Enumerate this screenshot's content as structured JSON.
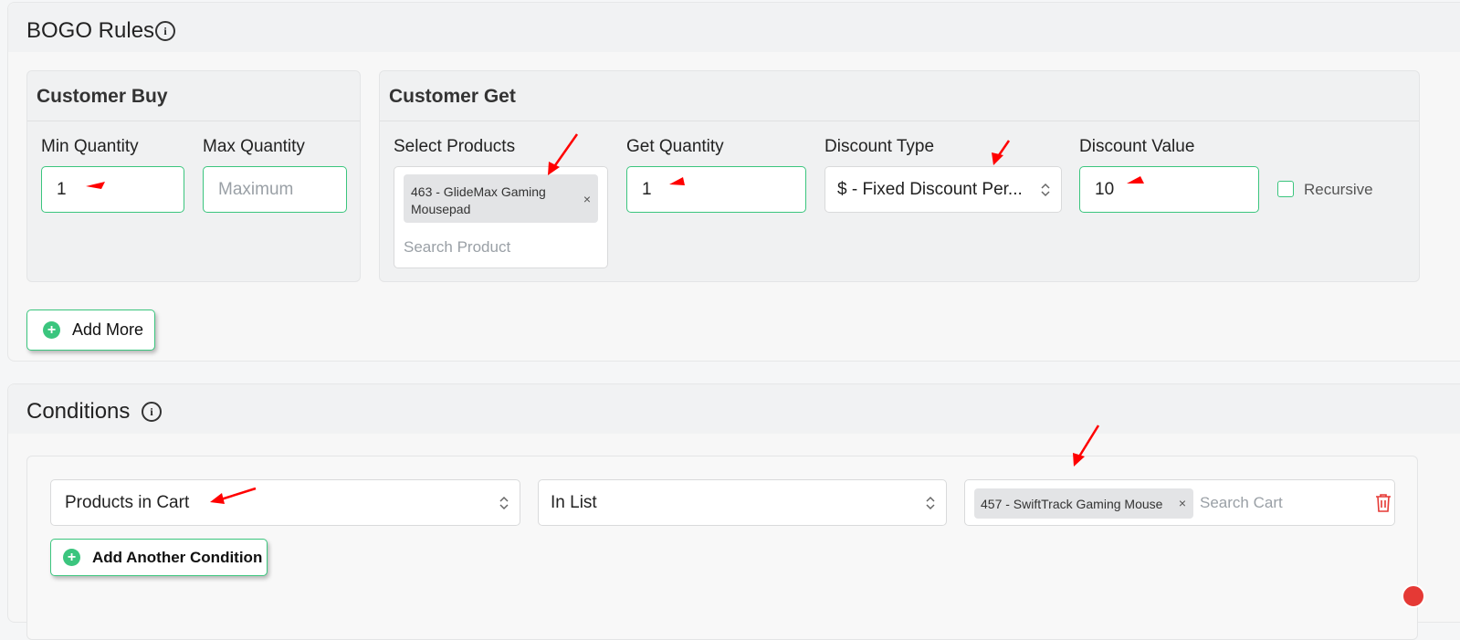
{
  "bogo": {
    "title": "BOGO Rules",
    "customer_buy": {
      "title": "Customer Buy",
      "min_label": "Min Quantity",
      "min_value": "1",
      "max_label": "Max Quantity",
      "max_placeholder": "Maximum"
    },
    "customer_get": {
      "title": "Customer Get",
      "select_products_label": "Select Products",
      "selected_product_line1": "463 - GlideMax Gaming",
      "selected_product_line2": "Mousepad",
      "search_placeholder": "Search Product",
      "get_quantity_label": "Get Quantity",
      "get_quantity_value": "1",
      "discount_type_label": "Discount Type",
      "discount_type_value": "$ - Fixed Discount Per...",
      "discount_value_label": "Discount Value",
      "discount_value": "10",
      "recursive_label": "Recursive"
    },
    "add_more_label": "Add More"
  },
  "conditions": {
    "title": "Conditions",
    "field_value": "Products in Cart",
    "operator_value": "In List",
    "selected_item": "457 - SwiftTrack Gaming Mouse",
    "search_placeholder": "Search Cart",
    "add_condition_label": "Add Another Condition"
  },
  "colors": {
    "accent": "#3bc57e",
    "annotation": "#ff0000",
    "delete": "#e53935"
  }
}
